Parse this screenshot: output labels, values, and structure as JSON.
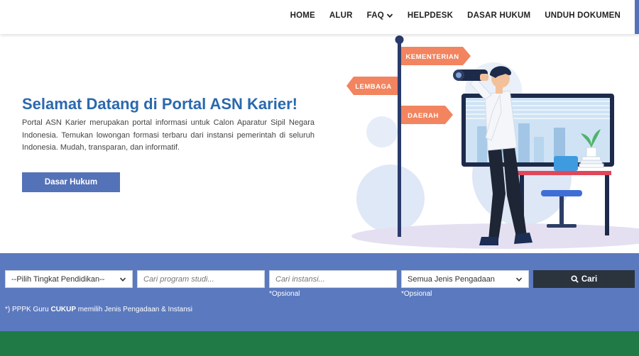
{
  "nav": {
    "items": [
      {
        "label": "HOME"
      },
      {
        "label": "ALUR"
      },
      {
        "label": "FAQ"
      },
      {
        "label": "HELPDESK"
      },
      {
        "label": "DASAR HUKUM"
      },
      {
        "label": "UNDUH DOKUMEN"
      }
    ]
  },
  "hero": {
    "title": "Selamat Datang di Portal ASN Karier!",
    "description": "Portal ASN Karier merupakan portal informasi untuk Calon Aparatur Sipil Negara Indonesia. Temukan lowongan formasi terbaru dari instansi pemerintah di seluruh Indonesia. Mudah, transparan, dan informatif.",
    "button_label": "Dasar Hukum"
  },
  "illustration": {
    "signs": [
      "KEMENTERIAN",
      "LEMBAGA",
      "DAERAH"
    ]
  },
  "search": {
    "education_select": "--Pilih Tingkat Pendidikan--",
    "program_placeholder": "Cari program studi...",
    "institution_placeholder": "Cari instansi...",
    "procurement_select": "Semua Jenis Pengadaan",
    "optional_hint": "*Opsional",
    "search_button": "Cari",
    "note_prefix": "*) PPPK Guru ",
    "note_bold": "CUKUP",
    "note_suffix": " memilih Jenis Pengadaan & Instansi"
  },
  "colors": {
    "primary": "#5472b8",
    "title": "#2a69ad",
    "band": "#5b79be",
    "dark_button": "#2b333d",
    "footer": "#1f7a46"
  }
}
